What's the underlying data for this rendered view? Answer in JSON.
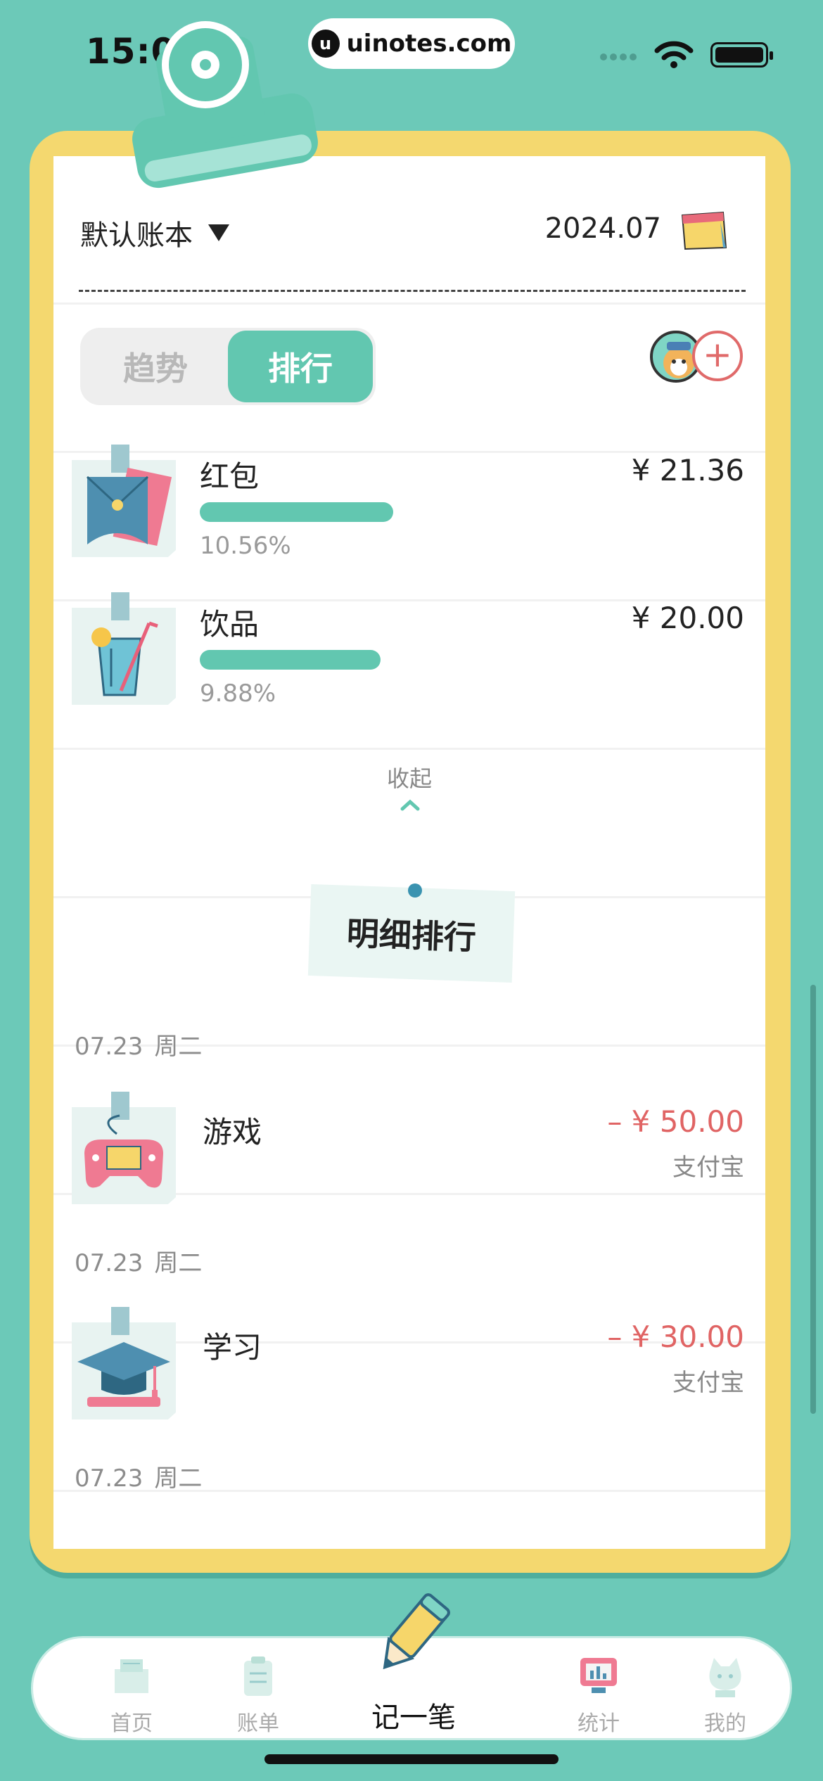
{
  "status_bar": {
    "time": "15:06",
    "url": "uinotes.com"
  },
  "header": {
    "book_name": "默认账本",
    "month": "2024.07"
  },
  "segment": {
    "tabs": [
      "趋势",
      "排行"
    ],
    "active": 1
  },
  "ranking": [
    {
      "name": "红包",
      "amount": "¥ 21.36",
      "percent": "10.56%",
      "share": 0.1056,
      "icon": "red-envelope-icon"
    },
    {
      "name": "饮品",
      "amount": "¥ 20.00",
      "percent": "9.88%",
      "share": 0.0988,
      "icon": "drink-icon"
    }
  ],
  "collapse_label": "收起",
  "detail_title": "明细排行",
  "details": [
    {
      "date": "07.23",
      "weekday": "周二",
      "name": "游戏",
      "amount": "– ¥ 50.00",
      "payment": "支付宝",
      "icon": "gamepad-icon"
    },
    {
      "date": "07.23",
      "weekday": "周二",
      "name": "学习",
      "amount": "– ¥ 30.00",
      "payment": "支付宝",
      "icon": "graduation-cap-icon"
    },
    {
      "date": "07.23",
      "weekday": "周二"
    }
  ],
  "tabbar": {
    "items": [
      "首页",
      "账单",
      "记一笔",
      "统计",
      "我的"
    ],
    "active": "统计"
  },
  "colors": {
    "accent": "#62c7b0",
    "expense": "#e06464",
    "background": "#6cc9b8",
    "board": "#f4d86f"
  }
}
